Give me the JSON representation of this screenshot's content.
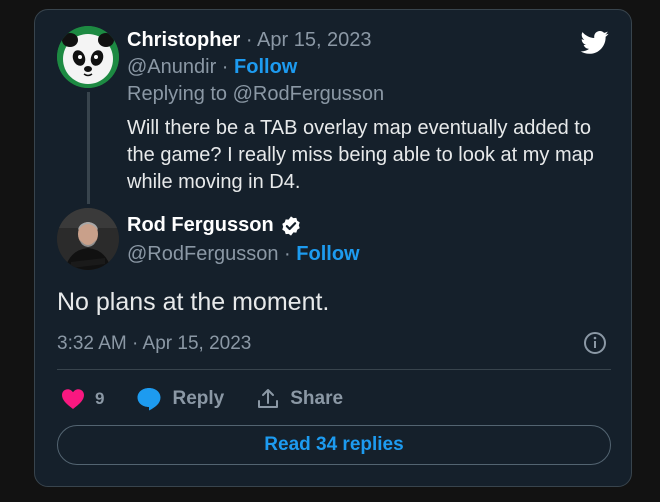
{
  "parent_tweet": {
    "name": "Christopher",
    "date": "Apr 15, 2023",
    "handle": "@Anundir",
    "follow_label": "Follow",
    "replying_to": "Replying to @RodFergusson",
    "text": "Will there be a TAB overlay map eventually added to the game? I really miss being able to look at my map while moving in D4."
  },
  "main_tweet": {
    "name": "Rod Fergusson",
    "handle": "@RodFergusson",
    "follow_label": "Follow",
    "text": "No plans at the moment.",
    "timestamp": "3:32 AM · Apr 15, 2023"
  },
  "actions": {
    "like_count": "9",
    "reply_label": "Reply",
    "share_label": "Share"
  },
  "read_replies_label": "Read 34 replies",
  "colors": {
    "background": "#15202b",
    "accent": "#1d9bf0",
    "like": "#f91880",
    "text": "#e7e9ea",
    "muted": "#8b98a5"
  }
}
